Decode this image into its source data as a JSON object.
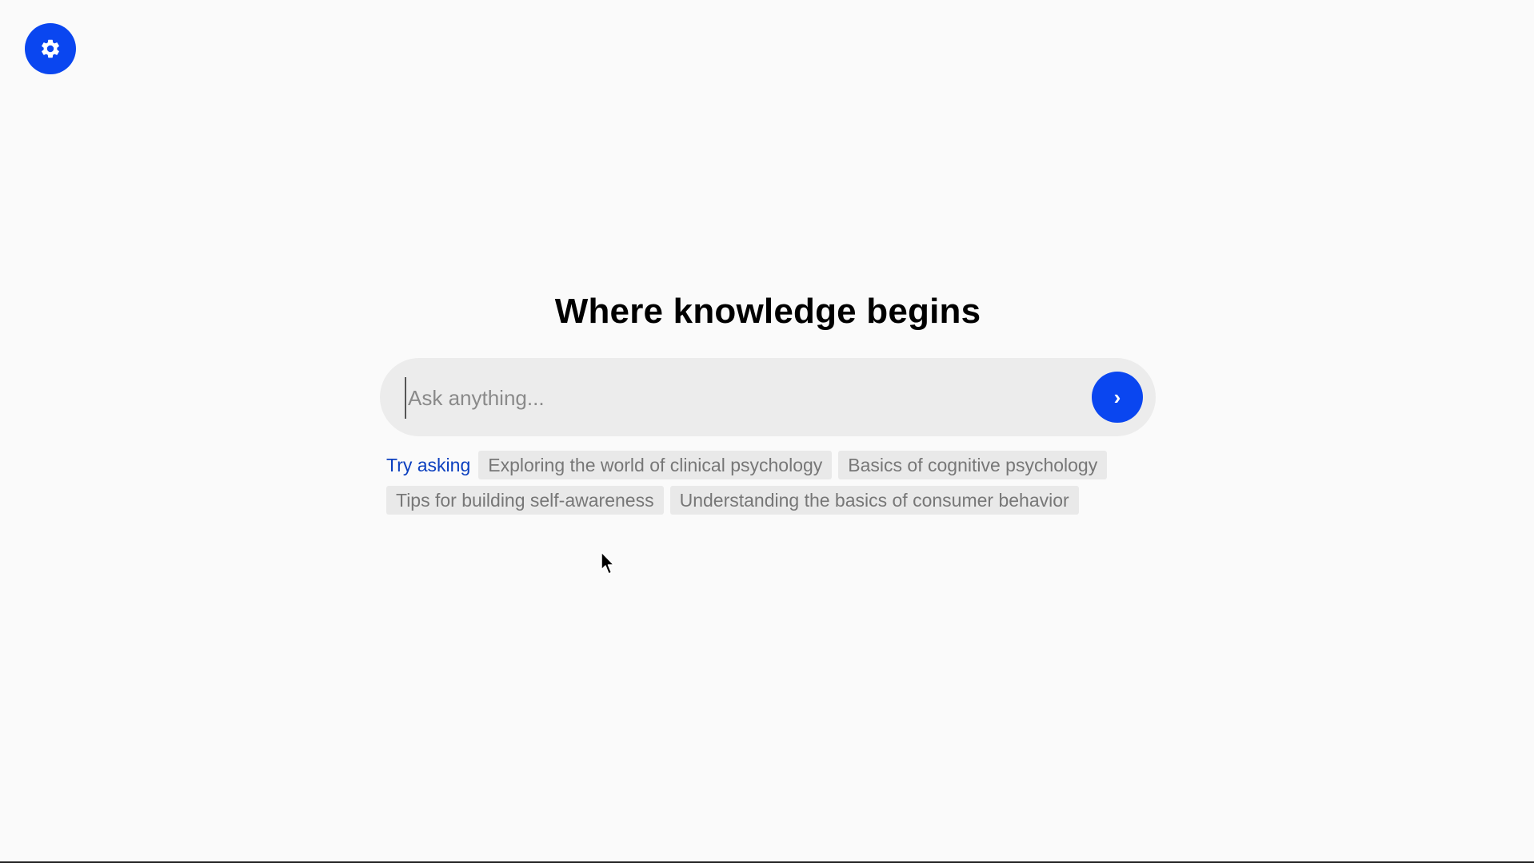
{
  "colors": {
    "accent": "#0a46f0",
    "try_label": "#0b3fbf",
    "background": "#fafafa",
    "chip_bg": "#e9e9e9"
  },
  "settings": {
    "icon": "gear-icon"
  },
  "main": {
    "title": "Where knowledge begins",
    "search": {
      "value": "",
      "placeholder": "Ask anything...",
      "submit_icon": "chevron-right-icon",
      "submit_label": "›"
    },
    "suggestions": {
      "label": "Try asking",
      "items": [
        {
          "label": "Exploring the world of clinical psychology"
        },
        {
          "label": "Basics of cognitive psychology"
        },
        {
          "label": "Tips for building self-awareness"
        },
        {
          "label": "Understanding the basics of consumer behavior"
        }
      ]
    }
  }
}
